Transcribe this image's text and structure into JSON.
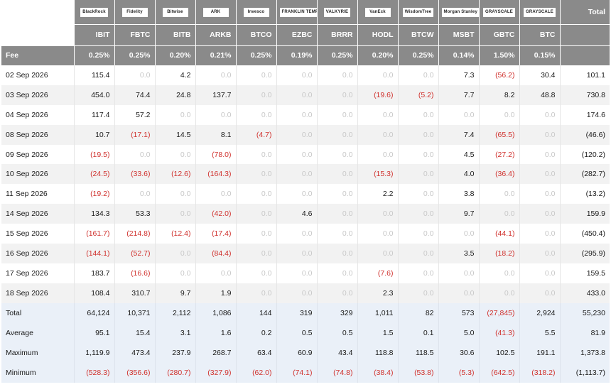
{
  "header": {
    "total_label": "Total",
    "fee_label": "Fee",
    "logos": [
      "BlackRock",
      "Fidelity",
      "Bitwise",
      "ARK",
      "Invesco",
      "FRANKLIN TEMPLETON",
      "VALKYRIE",
      "VanEck",
      "WisdomTree",
      "Morgan Stanley",
      "GRAYSCALE",
      "GRAYSCALE"
    ],
    "tickers": [
      "IBIT",
      "FBTC",
      "BITB",
      "ARKB",
      "BTCO",
      "EZBC",
      "BRRR",
      "HODL",
      "BTCW",
      "MSBT",
      "GBTC",
      "BTC"
    ],
    "fees": [
      "0.25%",
      "0.25%",
      "0.20%",
      "0.21%",
      "0.25%",
      "0.19%",
      "0.25%",
      "0.20%",
      "0.25%",
      "0.14%",
      "1.50%",
      "0.15%"
    ]
  },
  "rows": [
    {
      "date": "02 Sep 2026",
      "values": [
        "115.4",
        "0.0",
        "4.2",
        "0.0",
        "0.0",
        "0.0",
        "0.0",
        "0.0",
        "0.0",
        "7.3",
        "(56.2)",
        "30.4"
      ],
      "total": "101.1"
    },
    {
      "date": "03 Sep 2026",
      "values": [
        "454.0",
        "74.4",
        "24.8",
        "137.7",
        "0.0",
        "0.0",
        "0.0",
        "(19.6)",
        "(5.2)",
        "7.7",
        "8.2",
        "48.8"
      ],
      "total": "730.8"
    },
    {
      "date": "04 Sep 2026",
      "values": [
        "117.4",
        "57.2",
        "0.0",
        "0.0",
        "0.0",
        "0.0",
        "0.0",
        "0.0",
        "0.0",
        "0.0",
        "0.0",
        "0.0"
      ],
      "total": "174.6"
    },
    {
      "date": "08 Sep 2026",
      "values": [
        "10.7",
        "(17.1)",
        "14.5",
        "8.1",
        "(4.7)",
        "0.0",
        "0.0",
        "0.0",
        "0.0",
        "7.4",
        "(65.5)",
        "0.0"
      ],
      "total": "(46.6)"
    },
    {
      "date": "09 Sep 2026",
      "values": [
        "(19.5)",
        "0.0",
        "0.0",
        "(78.0)",
        "0.0",
        "0.0",
        "0.0",
        "0.0",
        "0.0",
        "4.5",
        "(27.2)",
        "0.0"
      ],
      "total": "(120.2)"
    },
    {
      "date": "10 Sep 2026",
      "values": [
        "(24.5)",
        "(33.6)",
        "(12.6)",
        "(164.3)",
        "0.0",
        "0.0",
        "0.0",
        "(15.3)",
        "0.0",
        "4.0",
        "(36.4)",
        "0.0"
      ],
      "total": "(282.7)"
    },
    {
      "date": "11 Sep 2026",
      "values": [
        "(19.2)",
        "0.0",
        "0.0",
        "0.0",
        "0.0",
        "0.0",
        "0.0",
        "2.2",
        "0.0",
        "3.8",
        "0.0",
        "0.0"
      ],
      "total": "(13.2)"
    },
    {
      "date": "14 Sep 2026",
      "values": [
        "134.3",
        "53.3",
        "0.0",
        "(42.0)",
        "0.0",
        "4.6",
        "0.0",
        "0.0",
        "0.0",
        "9.7",
        "0.0",
        "0.0"
      ],
      "total": "159.9"
    },
    {
      "date": "15 Sep 2026",
      "values": [
        "(161.7)",
        "(214.8)",
        "(12.4)",
        "(17.4)",
        "0.0",
        "0.0",
        "0.0",
        "0.0",
        "0.0",
        "0.0",
        "(44.1)",
        "0.0"
      ],
      "total": "(450.4)"
    },
    {
      "date": "16 Sep 2026",
      "values": [
        "(144.1)",
        "(52.7)",
        "0.0",
        "(84.4)",
        "0.0",
        "0.0",
        "0.0",
        "0.0",
        "0.0",
        "3.5",
        "(18.2)",
        "0.0"
      ],
      "total": "(295.9)"
    },
    {
      "date": "17 Sep 2026",
      "values": [
        "183.7",
        "(16.6)",
        "0.0",
        "0.0",
        "0.0",
        "0.0",
        "0.0",
        "(7.6)",
        "0.0",
        "0.0",
        "0.0",
        "0.0"
      ],
      "total": "159.5"
    },
    {
      "date": "18 Sep 2026",
      "values": [
        "108.4",
        "310.7",
        "9.7",
        "1.9",
        "0.0",
        "0.0",
        "0.0",
        "2.3",
        "0.0",
        "0.0",
        "0.0",
        "0.0"
      ],
      "total": "433.0"
    }
  ],
  "summary": [
    {
      "label": "Total",
      "values": [
        "64,124",
        "10,371",
        "2,112",
        "1,086",
        "144",
        "319",
        "329",
        "1,011",
        "82",
        "573",
        "(27,845)",
        "2,924"
      ],
      "total": "55,230"
    },
    {
      "label": "Average",
      "values": [
        "95.1",
        "15.4",
        "3.1",
        "1.6",
        "0.2",
        "0.5",
        "0.5",
        "1.5",
        "0.1",
        "5.0",
        "(41.3)",
        "5.5"
      ],
      "total": "81.9"
    },
    {
      "label": "Maximum",
      "values": [
        "1,119.9",
        "473.4",
        "237.9",
        "268.7",
        "63.4",
        "60.9",
        "43.4",
        "118.8",
        "118.5",
        "30.6",
        "102.5",
        "191.1"
      ],
      "total": "1,373.8"
    },
    {
      "label": "Minimum",
      "values": [
        "(528.3)",
        "(356.6)",
        "(280.7)",
        "(327.9)",
        "(62.0)",
        "(74.1)",
        "(74.8)",
        "(38.4)",
        "(53.8)",
        "(5.3)",
        "(642.5)",
        "(318.2)"
      ],
      "total": "(1,113.7)"
    }
  ],
  "colors": {
    "header_bg": "#8a8a8a",
    "negative": "#d0312d",
    "zero": "#c8c8c8",
    "stripe": "#f2f2f2",
    "summary_bg": "#eaf0f8"
  }
}
